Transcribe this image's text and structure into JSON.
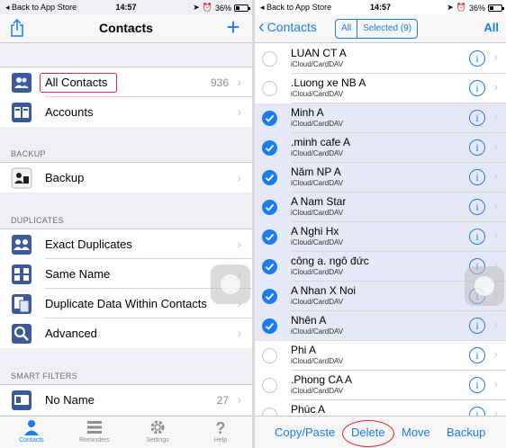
{
  "left": {
    "status": {
      "back": "Back to App Store",
      "time": "14:57",
      "battery": "36%"
    },
    "nav": {
      "title": "Contacts"
    },
    "rows": {
      "all_contacts": {
        "label": "All Contacts",
        "count": "936"
      },
      "accounts": {
        "label": "Accounts"
      },
      "backup_header": "BACKUP",
      "backup": {
        "label": "Backup"
      },
      "duplicates_header": "DUPLICATES",
      "exact": {
        "label": "Exact Duplicates"
      },
      "same_name": {
        "label": "Same Name"
      },
      "dup_data": {
        "label": "Duplicate Data Within Contacts"
      },
      "advanced": {
        "label": "Advanced"
      },
      "smart_header": "SMART FILTERS",
      "no_name": {
        "label": "No Name",
        "count": "27"
      }
    },
    "tabs": [
      {
        "label": "Contacts",
        "icon": "person-icon",
        "active": true
      },
      {
        "label": "Reminders",
        "icon": "list-icon",
        "active": false
      },
      {
        "label": "Settings",
        "icon": "gear-icon",
        "active": false
      },
      {
        "label": "Help",
        "icon": "question-icon",
        "active": false
      }
    ]
  },
  "right": {
    "status": {
      "back": "Back to App Store",
      "time": "14:57",
      "battery": "36%"
    },
    "nav": {
      "back_label": "Contacts",
      "seg_all": "All",
      "seg_selected": "Selected (9)",
      "select_all": "All"
    },
    "contacts": [
      {
        "name": "LUAN CT A",
        "source": "iCloud/CardDAV",
        "selected": false
      },
      {
        "name": ".Luong xe NB A",
        "source": "iCloud/CardDAV",
        "selected": false
      },
      {
        "name": "Minh A",
        "source": "iCloud/CardDAV",
        "selected": true
      },
      {
        "name": ".minh cafe A",
        "source": "iCloud/CardDAV",
        "selected": true
      },
      {
        "name": "Năm NP A",
        "source": "iCloud/CardDAV",
        "selected": true
      },
      {
        "name": "A Nam Star",
        "source": "iCloud/CardDAV",
        "selected": true
      },
      {
        "name": "A Nghi Hx",
        "source": "iCloud/CardDAV",
        "selected": true
      },
      {
        "name": "công a. ngô đức",
        "source": "iCloud/CardDAV",
        "selected": true
      },
      {
        "name": "A Nhan X Noi",
        "source": "iCloud/CardDAV",
        "selected": true
      },
      {
        "name": "Nhên A",
        "source": "iCloud/CardDAV",
        "selected": true
      },
      {
        "name": "Phi A",
        "source": "iCloud/CardDAV",
        "selected": false
      },
      {
        "name": ".Phong CA A",
        "source": "iCloud/CardDAV",
        "selected": false
      },
      {
        "name": "Phúc A",
        "source": "iCloud/CardDAV",
        "selected": false
      }
    ],
    "toolbar": {
      "copy_paste": "Copy/Paste",
      "delete": "Delete",
      "move": "Move",
      "backup": "Backup"
    }
  },
  "colors": {
    "accent": "#1a7cf5",
    "highlight": "#e0253d",
    "selected_row": "#e6e9f5"
  },
  "battery_level": 0.36
}
